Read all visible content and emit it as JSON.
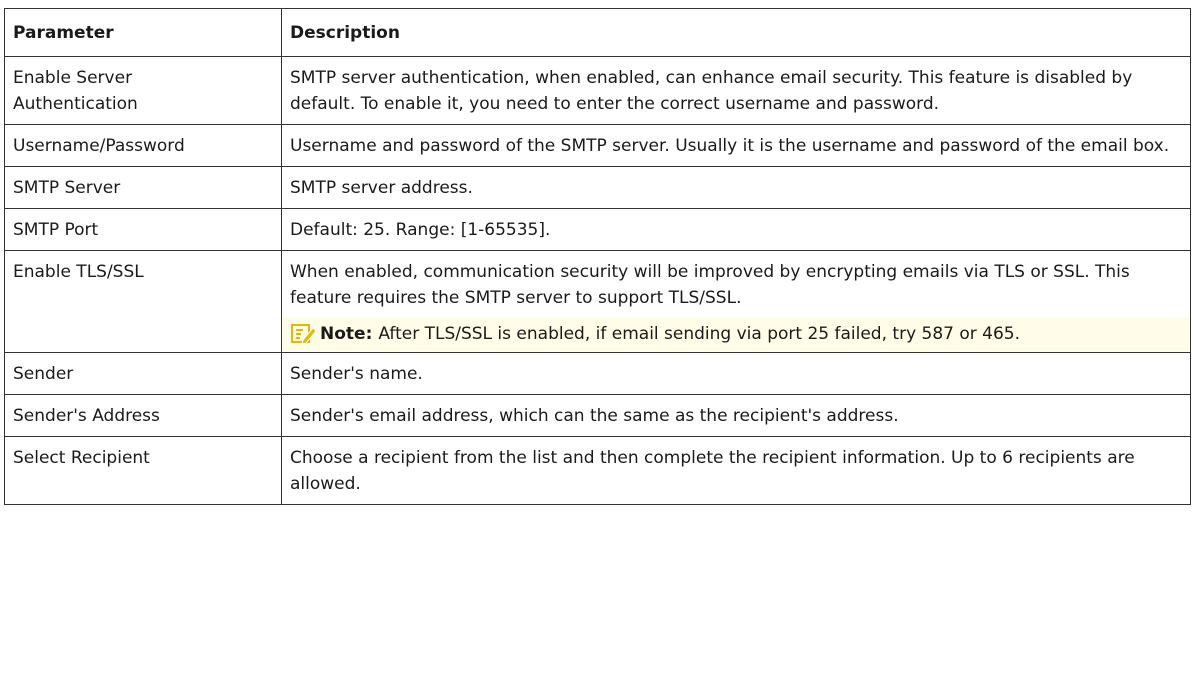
{
  "table": {
    "headers": {
      "parameter": "Parameter",
      "description": "Description"
    },
    "rows": [
      {
        "parameter": "Enable Server Authentication",
        "description": "SMTP server authentication, when enabled, can enhance email security. This feature is disabled by default. To enable it, you need to enter the correct username and password."
      },
      {
        "parameter": "Username/Password",
        "description": "Username and password of the SMTP server. Usually it is the username and password of the email box."
      },
      {
        "parameter": "SMTP Server",
        "description": "SMTP server address."
      },
      {
        "parameter": "SMTP Port",
        "description": "Default: 25. Range: [1-65535]."
      },
      {
        "parameter": "Enable TLS/SSL",
        "description": "When enabled, communication security will be improved by encrypting emails via TLS or SSL. This feature requires the SMTP server to support TLS/SSL.",
        "note_label": "Note:",
        "note_text": "After TLS/SSL is enabled, if email sending via port 25 failed, try 587 or 465."
      },
      {
        "parameter": "Sender",
        "description": "Sender's name."
      },
      {
        "parameter": "Sender's Address",
        "description": "Sender's email address, which can the same as the recipient's address."
      },
      {
        "parameter": "Select Recipient",
        "description": "Choose a recipient from the list and then complete the recipient information. Up to 6 recipients are allowed."
      }
    ]
  },
  "colors": {
    "border": "#333333",
    "note_background": "#fffde8",
    "note_icon": "#e8b800"
  },
  "icons": {
    "note": "note-pencil-icon"
  }
}
